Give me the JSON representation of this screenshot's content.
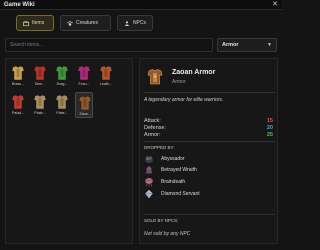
{
  "window": {
    "title": "Game Wiki",
    "close_glyph": "✕"
  },
  "tabs": [
    {
      "label": "Items",
      "icon": "chest-icon",
      "active": true
    },
    {
      "label": "Creatures",
      "icon": "paw-icon",
      "active": false
    },
    {
      "label": "NPCs",
      "icon": "person-icon",
      "active": false
    }
  ],
  "search": {
    "placeholder": "Search items..."
  },
  "filter": {
    "selected": "Armor",
    "chevron": "▼"
  },
  "items": [
    {
      "label": "Brass...",
      "icon": "armor-brass-icon",
      "color": "#c8a24a"
    },
    {
      "label": "Dem...",
      "icon": "armor-demon-icon",
      "color": "#b8342b"
    },
    {
      "label": "Drag...",
      "icon": "armor-dragon-icon",
      "color": "#3f9b3a"
    },
    {
      "label": "Focu...",
      "icon": "armor-focus-icon",
      "color": "#b02a78"
    },
    {
      "label": "Leath...",
      "icon": "armor-leather-icon",
      "color": "#b5542a"
    },
    {
      "label": "Palad...",
      "icon": "armor-paladin-icon",
      "color": "#c23b2e"
    },
    {
      "label": "Plate...",
      "icon": "armor-plate-icon",
      "color": "#b09060"
    },
    {
      "label": "Plate...",
      "icon": "armor-plate-icon",
      "color": "#a98c5e"
    },
    {
      "label": "Zaoa...",
      "icon": "armor-zaoan-icon",
      "color": "#8e5a2c",
      "selected": true
    }
  ],
  "detail": {
    "name": "Zaoan Armor",
    "category": "Armor",
    "icon": "armor-zaoan-icon",
    "description": "A legendary armor for elite warriors.",
    "stats": [
      {
        "label": "Attack:",
        "value": "15",
        "color": "#e0503a"
      },
      {
        "label": "Defense:",
        "value": "20",
        "color": "#4aa0e0"
      },
      {
        "label": "Armor:",
        "value": "25",
        "color": "#4cc05a"
      }
    ],
    "dropped_by_heading": "DROPPED BY:",
    "dropped_by": [
      {
        "name": "Abyssador",
        "icon": "abyssador-icon"
      },
      {
        "name": "Betrayed Wraith",
        "icon": "wraith-icon"
      },
      {
        "name": "Braindeath",
        "icon": "braindeath-icon"
      },
      {
        "name": "Diamond Servant",
        "icon": "diamond-servant-icon"
      }
    ],
    "sold_by_heading": "SOLD BY NPCS:",
    "sold_by_text": "Not sold by any NPC"
  },
  "colors": {
    "accent": "#7c6b2c",
    "background": "#141414"
  }
}
